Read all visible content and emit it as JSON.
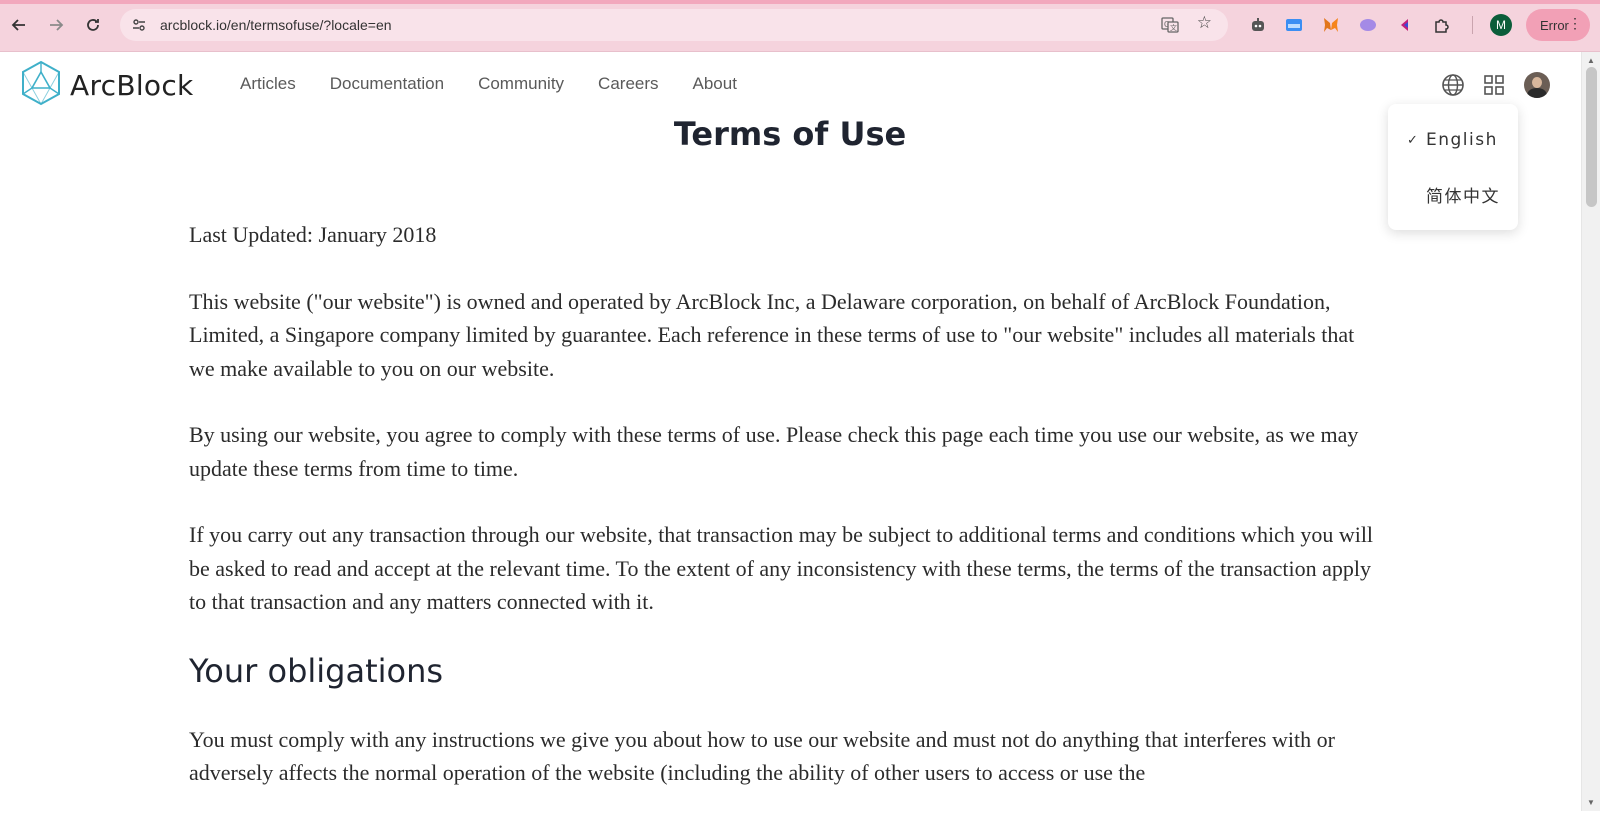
{
  "browser": {
    "url": "arcblock.io/en/termsofuse/?locale=en",
    "profile_initial": "M",
    "error_label": "Error"
  },
  "header": {
    "logo_text": "ArcBlock",
    "nav": [
      "Articles",
      "Documentation",
      "Community",
      "Careers",
      "About"
    ]
  },
  "language_menu": {
    "items": [
      {
        "label": "English",
        "selected": true
      },
      {
        "label": "简体中文",
        "selected": false
      }
    ]
  },
  "page": {
    "title": "Terms of Use",
    "last_updated": "Last Updated: January 2018",
    "paragraphs": [
      "This website (\"our website\") is owned and operated by ArcBlock Inc, a Delaware corporation, on behalf of ArcBlock Foundation, Limited, a Singapore company limited by guarantee. Each reference in these terms of use to \"our website\" includes all materials that we make available to you on our website.",
      "By using our website, you agree to comply with these terms of use. Please check this page each time you use our website, as we may update these terms from time to time.",
      "If you carry out any transaction through our website, that transaction may be subject to additional terms and conditions which you will be asked to read and accept at the relevant time. To the extent of any inconsistency with these terms, the terms of the transaction apply to that transaction and any matters connected with it."
    ],
    "section_heading": "Your obligations",
    "section_paragraph": "You must comply with any instructions we give you about how to use our website and must not do anything that interferes with or adversely affects the normal operation of the website (including the ability of other users to access or use the"
  },
  "icons": {
    "back": "back-arrow-icon",
    "forward": "forward-arrow-icon",
    "reload": "reload-icon",
    "globe": "globe-icon",
    "apps": "grid-icon"
  },
  "colors": {
    "chrome_bg": "#f5d3dd",
    "logo_accent": "#3fb0c9",
    "title": "#1f2430"
  }
}
